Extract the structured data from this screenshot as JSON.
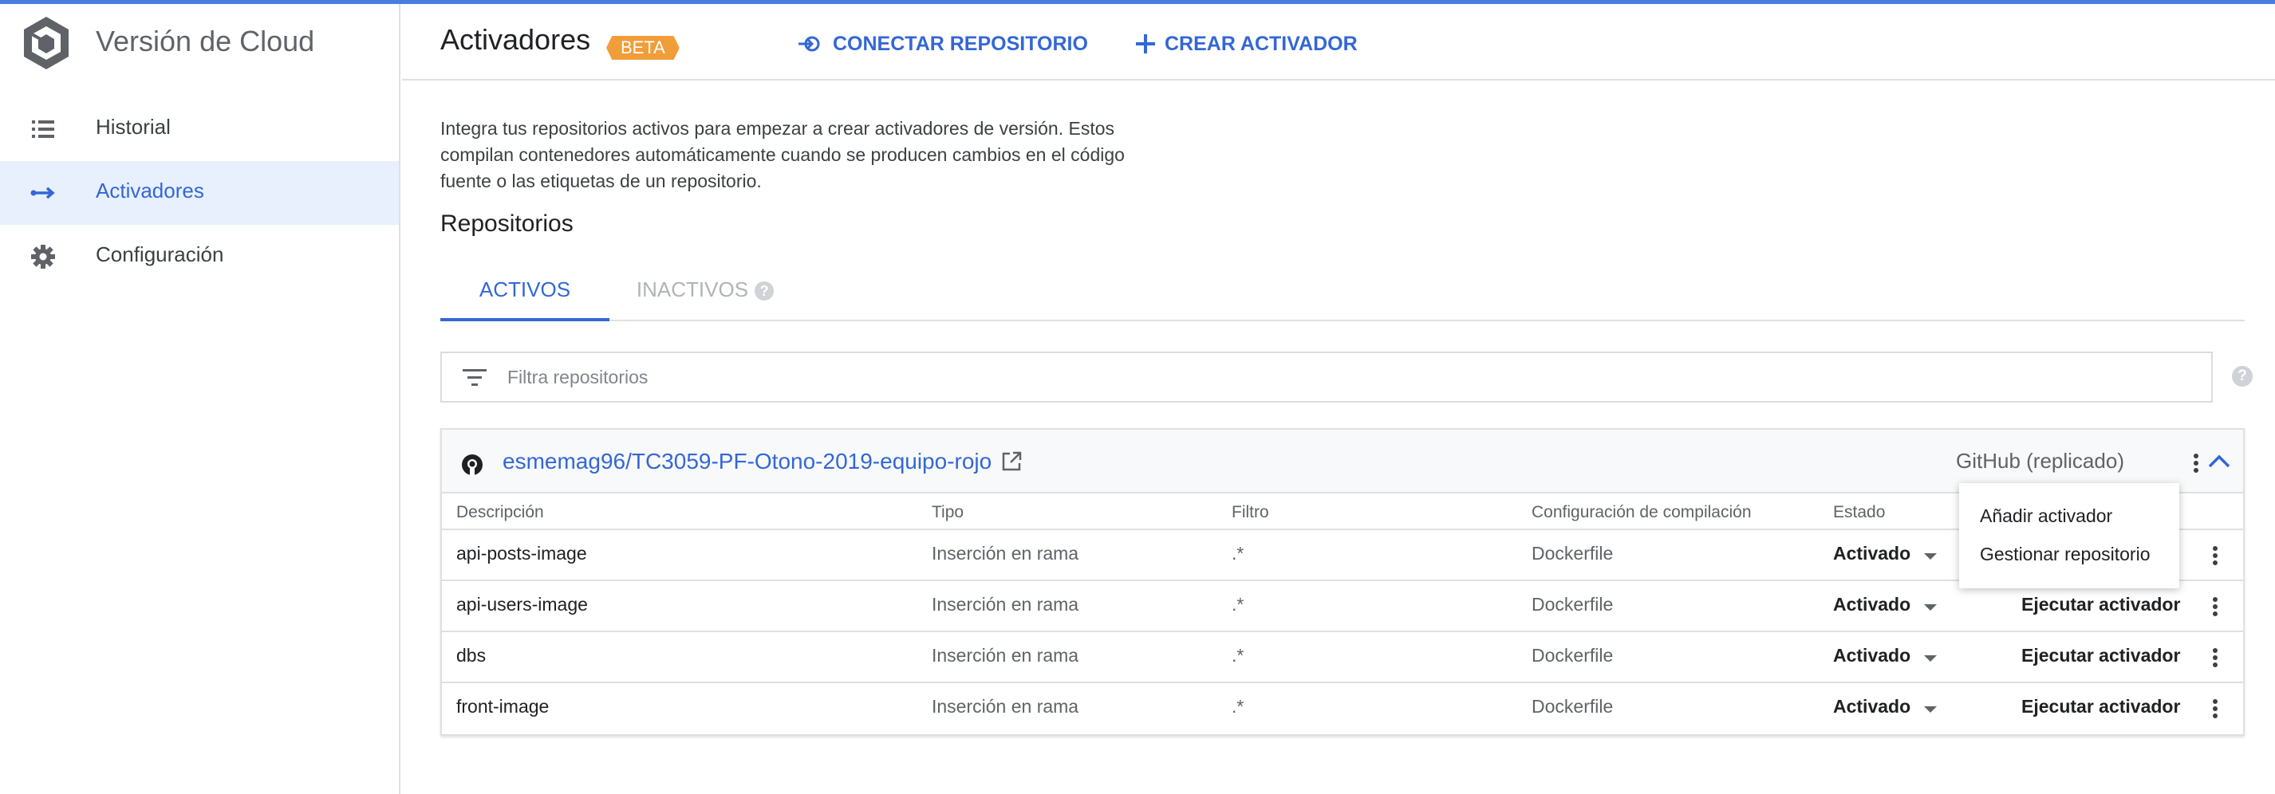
{
  "app": {
    "title": "Versión de Cloud",
    "logo_icon": "cloud-build-logo-icon",
    "accent_color": "#3367d6"
  },
  "sidebar": {
    "items": [
      {
        "label": "Historial",
        "icon": "list-icon",
        "active": false
      },
      {
        "label": "Activadores",
        "icon": "trigger-arrow-icon",
        "active": true
      },
      {
        "label": "Configuración",
        "icon": "gear-icon",
        "active": false
      }
    ]
  },
  "header": {
    "title": "Activadores",
    "badge": "BETA",
    "connect_label": "CONECTAR REPOSITORIO",
    "create_label": "CREAR ACTIVADOR"
  },
  "main": {
    "intro": "Integra tus repositorios activos para empezar a crear activadores de versión. Estos compilan contenedores automáticamente cuando se producen cambios en el código fuente o las etiquetas de un repositorio.",
    "section_title": "Repositorios",
    "tabs": [
      {
        "label": "ACTIVOS",
        "active": true
      },
      {
        "label": "INACTIVOS",
        "active": false
      }
    ],
    "filter_placeholder": "Filtra repositorios",
    "repo": {
      "name": "esmemag96/TC3059-PF-Otono-2019-equipo-rojo",
      "source": "GitHub (replicado)",
      "columns": [
        "Descripción",
        "Tipo",
        "Filtro",
        "Configuración de compilación",
        "Estado"
      ],
      "rows": [
        {
          "description": "api-posts-image",
          "type": "Inserción en rama",
          "filter": ".*",
          "config": "Dockerfile",
          "status": "Activado",
          "action": ""
        },
        {
          "description": "api-users-image",
          "type": "Inserción en rama",
          "filter": ".*",
          "config": "Dockerfile",
          "status": "Activado",
          "action": "Ejecutar activador"
        },
        {
          "description": "dbs",
          "type": "Inserción en rama",
          "filter": ".*",
          "config": "Dockerfile",
          "status": "Activado",
          "action": "Ejecutar activador"
        },
        {
          "description": "front-image",
          "type": "Inserción en rama",
          "filter": ".*",
          "config": "Dockerfile",
          "status": "Activado",
          "action": "Ejecutar activador"
        }
      ]
    },
    "context_menu": {
      "items": [
        "Añadir activador",
        "Gestionar repositorio"
      ]
    }
  }
}
